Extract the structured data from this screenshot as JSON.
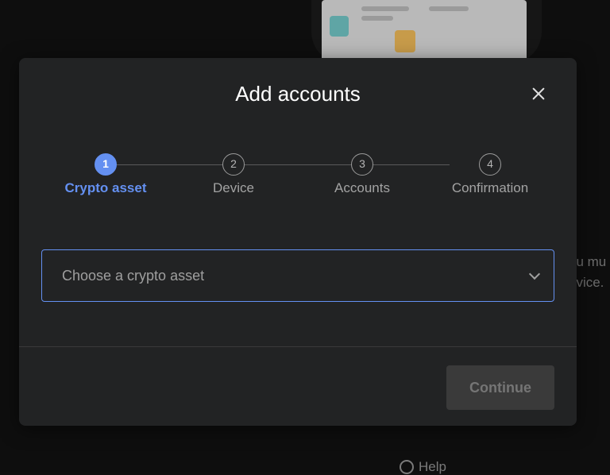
{
  "background": {
    "side_text_line1": "ou mu",
    "side_text_line2": "evice.",
    "help_label": "Help"
  },
  "modal": {
    "title": "Add accounts",
    "close_icon": "close-icon",
    "steps": [
      {
        "number": "1",
        "label": "Crypto asset",
        "active": true
      },
      {
        "number": "2",
        "label": "Device",
        "active": false
      },
      {
        "number": "3",
        "label": "Accounts",
        "active": false
      },
      {
        "number": "4",
        "label": "Confirmation",
        "active": false
      }
    ],
    "select": {
      "placeholder": "Choose a crypto asset",
      "icon": "chevron-down-icon"
    },
    "continue_label": "Continue"
  },
  "colors": {
    "accent": "#6490f1",
    "modal_bg": "#222324",
    "disabled_button": "#3a3a3a"
  }
}
